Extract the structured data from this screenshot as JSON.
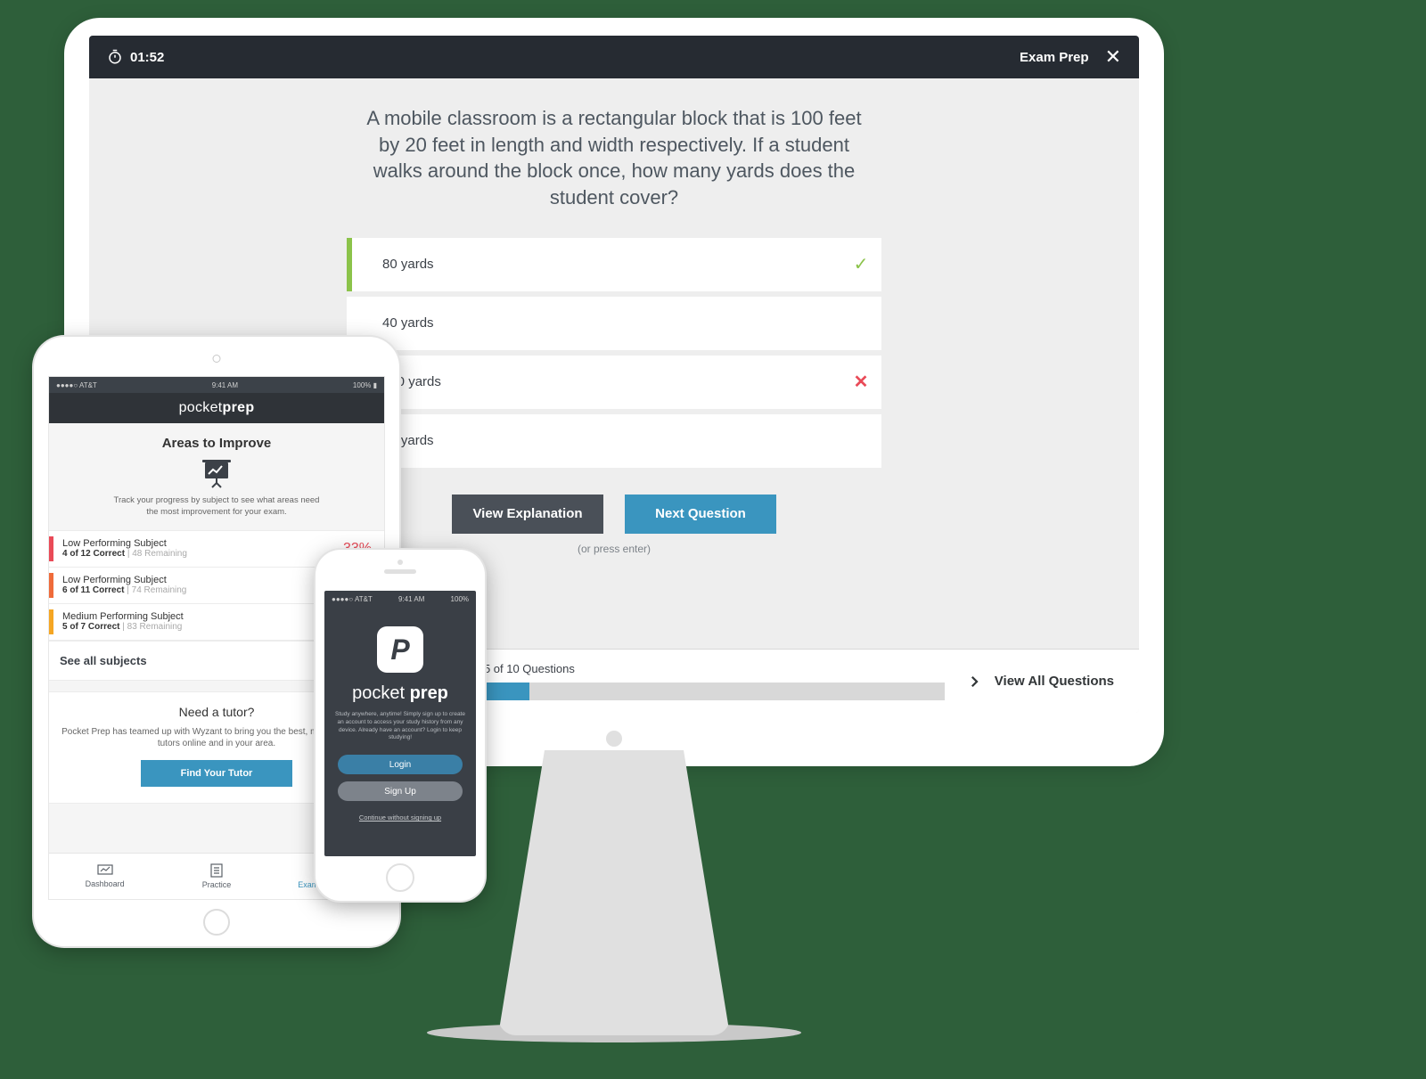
{
  "desktop": {
    "timer": "01:52",
    "header_label": "Exam Prep",
    "question": "A mobile classroom is a rectangular block that is 100 feet by 20 feet in length and width respectively. If a student walks around the block once, how many yards does the student cover?",
    "answers": [
      {
        "label": "80 yards",
        "state": "correct",
        "mark": "✓"
      },
      {
        "label": "40 yards",
        "state": "",
        "mark": ""
      },
      {
        "label": "120 yards",
        "state": "wrong",
        "mark": "✕"
      },
      {
        "label": "60 yards",
        "state": "",
        "mark": ""
      }
    ],
    "view_explanation": "View Explanation",
    "next_question": "Next Question",
    "hint": "(or press enter)",
    "progress_label": "5 of 10 Questions",
    "progress_pct": 50,
    "view_all": "View All Questions"
  },
  "ipad": {
    "status": {
      "carrier": "AT&T",
      "time": "9:41 AM",
      "battery": "100%"
    },
    "app_title_light": "pocket ",
    "app_title_bold": "prep",
    "section_title": "Areas to Improve",
    "section_sub": "Track your progress by subject to see what areas need the most improvement for your exam.",
    "subjects": [
      {
        "class": "red",
        "name": "Low Performing Subject",
        "score": "4 of 12 Correct",
        "remaining": "48 Remaining",
        "pct": "33%"
      },
      {
        "class": "ored",
        "name": "Low Performing Subject",
        "score": "6 of 11 Correct",
        "remaining": "74 Remaining",
        "pct": ""
      },
      {
        "class": "orange",
        "name": "Medium Performing Subject",
        "score": "5 of 7 Correct",
        "remaining": "83 Remaining",
        "pct": ""
      }
    ],
    "see_all": "See all subjects",
    "tutor_title": "Need a tutor?",
    "tutor_body": "Pocket Prep has teamed up with Wyzant to bring you the best, most affordable tutors online and in your area.",
    "tutor_btn": "Find Your Tutor",
    "tabs": {
      "dashboard": "Dashboard",
      "practice": "Practice",
      "readiness": "Exam Readiness"
    }
  },
  "iphone": {
    "status": {
      "carrier": "AT&T",
      "time": "9:41 AM",
      "battery": "100%"
    },
    "brand_light": "pocket ",
    "brand_bold": "prep",
    "tagline": "Study anywhere, anytime! Simply sign up to create an account to access your study history from any device. Already have an account? Login to keep studying!",
    "login": "Login",
    "signup": "Sign Up",
    "skip": "Continue without signing up"
  }
}
